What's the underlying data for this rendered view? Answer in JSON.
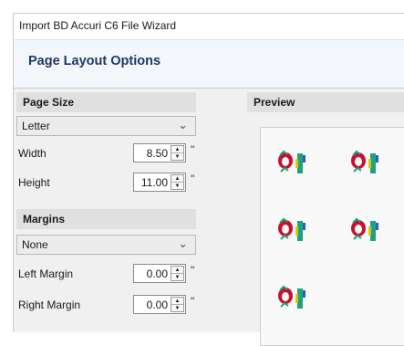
{
  "window": {
    "title": "Import BD Accuri C6 File Wizard"
  },
  "header": {
    "title": "Page Layout Options"
  },
  "page_size": {
    "heading": "Page Size",
    "selected": "Letter",
    "width_label": "Width",
    "width_value": "8.50",
    "height_label": "Height",
    "height_value": "11.00",
    "unit": "\""
  },
  "margins": {
    "heading": "Margins",
    "selected": "None",
    "left_label": "Left Margin",
    "left_value": "0.00",
    "right_label": "Right Margin",
    "right_value": "0.00",
    "unit": "\""
  },
  "preview": {
    "heading": "Preview",
    "plot_count": 5
  },
  "icons": {
    "dropdown": "chevron-down-icon",
    "spinner_up": "arrow-up-icon",
    "spinner_down": "arrow-down-icon",
    "preview_plot": "flow-cytometry-plot-icon"
  },
  "colors": {
    "header_title": "#203864",
    "section_bg": "#e0e0e0",
    "panel_bg": "#f0f0f0"
  }
}
